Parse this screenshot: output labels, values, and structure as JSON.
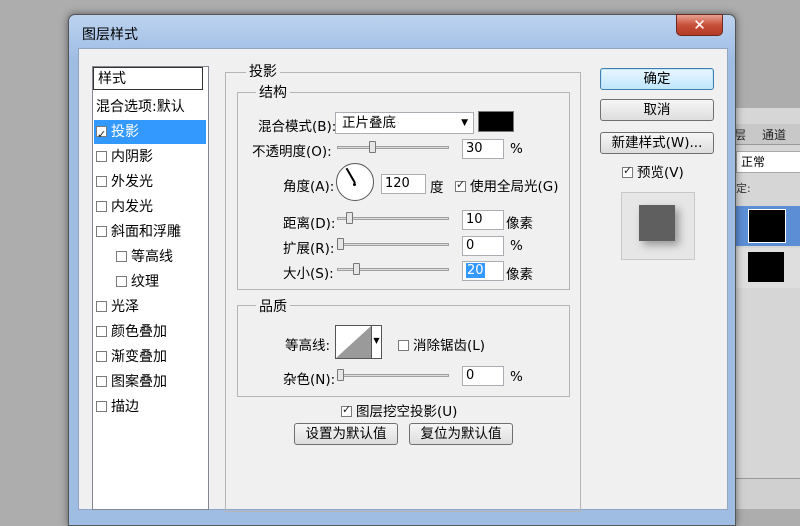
{
  "dialog": {
    "title": "图层样式",
    "close_glyph": "✕"
  },
  "styles_list": {
    "header": "样式",
    "items": [
      {
        "label": "混合选项:默认",
        "checkbox": false,
        "checked": false,
        "selected": false,
        "indent": false
      },
      {
        "label": "投影",
        "checkbox": true,
        "checked": true,
        "selected": true,
        "indent": false
      },
      {
        "label": "内阴影",
        "checkbox": true,
        "checked": false,
        "selected": false,
        "indent": false
      },
      {
        "label": "外发光",
        "checkbox": true,
        "checked": false,
        "selected": false,
        "indent": false
      },
      {
        "label": "内发光",
        "checkbox": true,
        "checked": false,
        "selected": false,
        "indent": false
      },
      {
        "label": "斜面和浮雕",
        "checkbox": true,
        "checked": false,
        "selected": false,
        "indent": false
      },
      {
        "label": "等高线",
        "checkbox": true,
        "checked": false,
        "selected": false,
        "indent": true
      },
      {
        "label": "纹理",
        "checkbox": true,
        "checked": false,
        "selected": false,
        "indent": true
      },
      {
        "label": "光泽",
        "checkbox": true,
        "checked": false,
        "selected": false,
        "indent": false
      },
      {
        "label": "颜色叠加",
        "checkbox": true,
        "checked": false,
        "selected": false,
        "indent": false
      },
      {
        "label": "渐变叠加",
        "checkbox": true,
        "checked": false,
        "selected": false,
        "indent": false
      },
      {
        "label": "图案叠加",
        "checkbox": true,
        "checked": false,
        "selected": false,
        "indent": false
      },
      {
        "label": "描边",
        "checkbox": true,
        "checked": false,
        "selected": false,
        "indent": false
      }
    ]
  },
  "drop_shadow": {
    "section_title": "投影",
    "structure": {
      "title": "结构",
      "blend_mode_label": "混合模式(B):",
      "blend_mode_value": "正片叠底",
      "shadow_color": "#000000",
      "opacity_label": "不透明度(O):",
      "opacity_value": "30",
      "opacity_unit": "%",
      "opacity_fraction": 0.3,
      "angle_label": "角度(A):",
      "angle_value": "120",
      "angle_unit": "度",
      "global_light_label": "使用全局光(G)",
      "global_light_checked": true,
      "distance_label": "距离(D):",
      "distance_value": "10",
      "distance_unit": "像素",
      "spread_label": "扩展(R):",
      "spread_value": "0",
      "spread_unit": "%",
      "size_label": "大小(S):",
      "size_value": "20",
      "size_unit": "像素"
    },
    "quality": {
      "title": "品质",
      "contour_label": "等高线:",
      "anti_alias_label": "消除锯齿(L)",
      "anti_alias_checked": false,
      "noise_label": "杂色(N):",
      "noise_value": "0",
      "noise_unit": "%"
    },
    "knockout_label": "图层挖空投影(U)",
    "knockout_checked": true,
    "make_default_button": "设置为默认值",
    "reset_default_button": "复位为默认值"
  },
  "buttons": {
    "ok": "确定",
    "cancel": "取消",
    "new_style": "新建样式(W)...",
    "preview_label": "预览(V)",
    "preview_checked": true
  },
  "background_panel": {
    "tab_layers_fragment": "层",
    "tab_channels": "通道",
    "blend_fragment": "正常",
    "lock_fragment": "定:"
  },
  "colors": {
    "selection": "#3399ff",
    "preview_square": "#5f5f5f"
  }
}
